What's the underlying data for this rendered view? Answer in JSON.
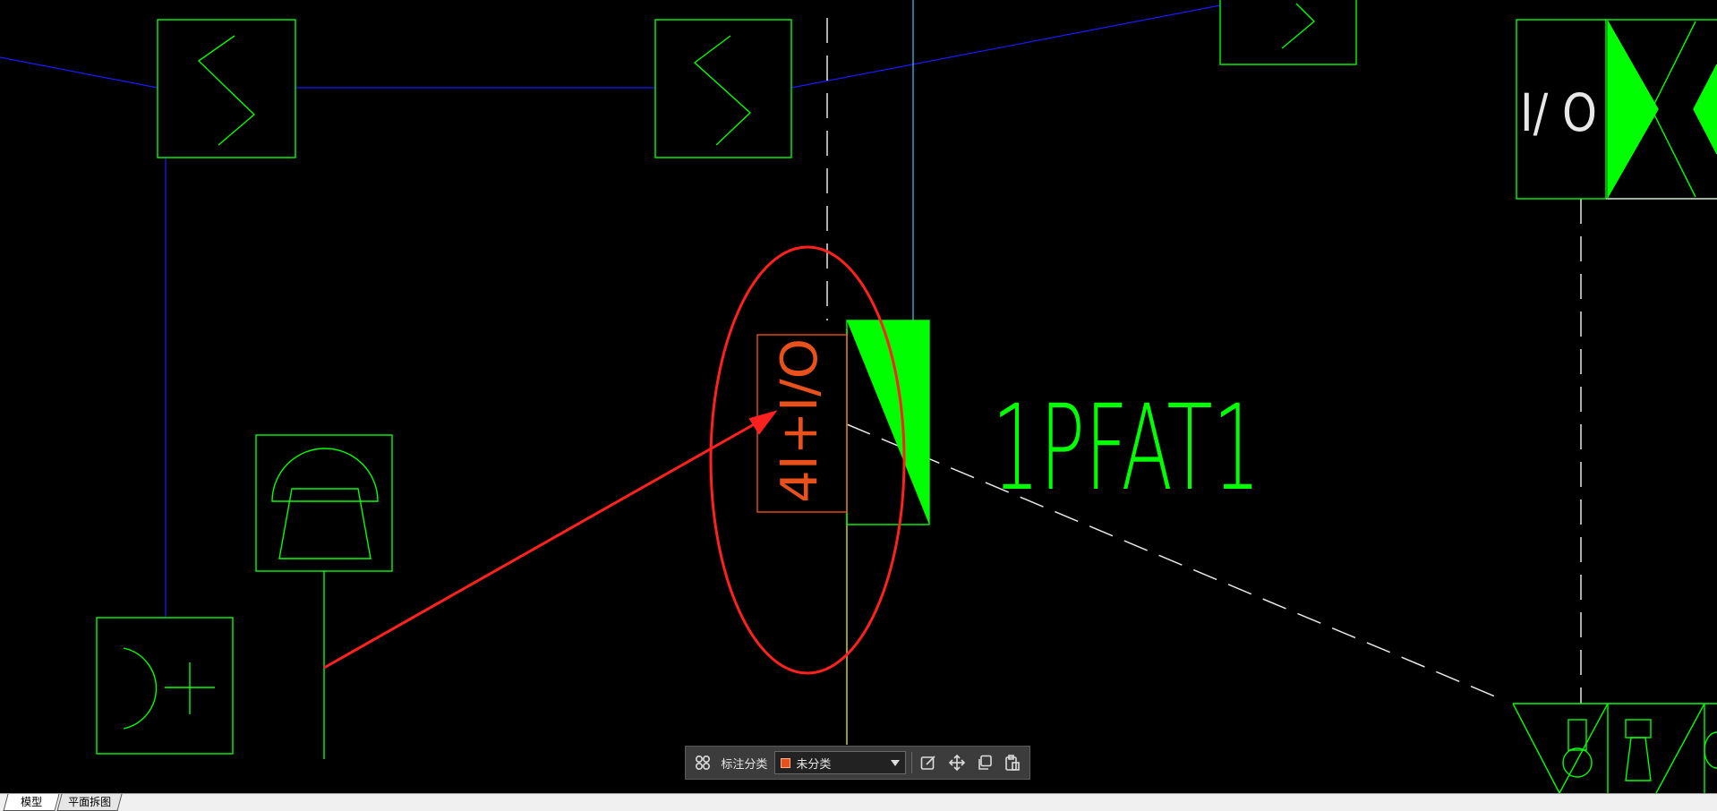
{
  "drawing": {
    "block_label": "1PFAT1",
    "io_module_label": "I/ O",
    "rotated_block_label": "4I+I/O"
  },
  "toolbar": {
    "icon_group": "grid-icon",
    "category_label": "标注分类",
    "category_value": "未分类",
    "category_color": "#e8501c",
    "tools": [
      "edit-icon",
      "move-icon",
      "copy-icon",
      "paste-icon"
    ]
  },
  "tabs": {
    "model": "模型",
    "plan_split": "平面拆图"
  },
  "colors": {
    "background": "#000000",
    "symbol": "#00ff00",
    "bus_line": "#0000ff",
    "dashed": "#ffffff",
    "annotation": "#ff2020",
    "selected_block": "#e8501c"
  }
}
